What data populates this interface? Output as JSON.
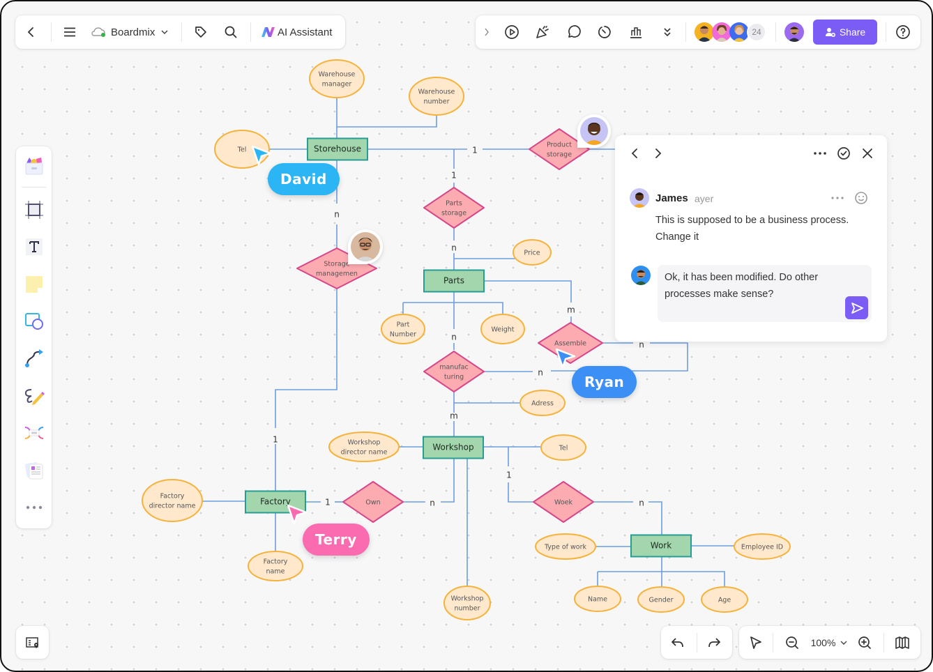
{
  "toolbar_left": {
    "back_icon": "chevron-left-icon",
    "menu_icon": "hamburger-menu-icon",
    "board_name": "Boardmix",
    "cloud_status": "synced",
    "tag_icon": "tag-icon",
    "search_icon": "search-icon",
    "ai_assistant_label": "AI Assistant"
  },
  "toolbar_right": {
    "expand_icon": "chevron-right-icon",
    "tools": [
      "present-icon",
      "celebrate-icon",
      "comment-icon",
      "timer-icon",
      "vote-icon",
      "more-chevrons-icon"
    ],
    "collaborator_count": "24",
    "share_label": "Share",
    "help_icon": "help-icon"
  },
  "left_toolbar": {
    "items": [
      "templates",
      "frame",
      "text",
      "sticky-note",
      "shapes",
      "connector",
      "pen",
      "mind-map",
      "document",
      "more"
    ]
  },
  "diagram": {
    "entities": [
      {
        "id": "storehouse",
        "label": "Storehouse"
      },
      {
        "id": "parts",
        "label": "Parts"
      },
      {
        "id": "workshop",
        "label": "Workshop"
      },
      {
        "id": "factory",
        "label": "Factory"
      },
      {
        "id": "work",
        "label": "Work"
      }
    ],
    "relationships": [
      {
        "id": "product-storage",
        "label": [
          "Product",
          "storage"
        ]
      },
      {
        "id": "parts-storage",
        "label": [
          "Parts",
          "storage"
        ]
      },
      {
        "id": "storage-management",
        "label": [
          "Storage",
          "managemen"
        ]
      },
      {
        "id": "assemble",
        "label": [
          "Assemble"
        ]
      },
      {
        "id": "manufacturing",
        "label": [
          "manufac",
          "turing"
        ]
      },
      {
        "id": "own",
        "label": [
          "Own"
        ]
      },
      {
        "id": "woek",
        "label": [
          "Woek"
        ]
      }
    ],
    "attributes": [
      {
        "id": "warehouse-manager",
        "label": [
          "Warehouse",
          "manager"
        ]
      },
      {
        "id": "warehouse-number",
        "label": [
          "Warehouse",
          "number"
        ]
      },
      {
        "id": "storehouse-tel",
        "label": [
          "Tel"
        ]
      },
      {
        "id": "price",
        "label": [
          "Price"
        ]
      },
      {
        "id": "part-number",
        "label": [
          "Part",
          "Number"
        ]
      },
      {
        "id": "weight",
        "label": [
          "Weight"
        ]
      },
      {
        "id": "adress",
        "label": [
          "Adress"
        ]
      },
      {
        "id": "workshop-director-name",
        "label": [
          "Workshop",
          "director name"
        ]
      },
      {
        "id": "workshop-tel",
        "label": [
          "Tel"
        ]
      },
      {
        "id": "workshop-number",
        "label": [
          "Workshop",
          "number"
        ]
      },
      {
        "id": "factory-director-name",
        "label": [
          "Factory",
          "director name"
        ]
      },
      {
        "id": "factory-name",
        "label": [
          "Factory",
          "name"
        ]
      },
      {
        "id": "type-of-work",
        "label": [
          "Type of work"
        ]
      },
      {
        "id": "employee-id",
        "label": [
          "Employee ID"
        ]
      },
      {
        "id": "name",
        "label": [
          "Name"
        ]
      },
      {
        "id": "gender",
        "label": [
          "Gender"
        ]
      },
      {
        "id": "age",
        "label": [
          "Age"
        ]
      }
    ],
    "cardinalities": [
      "1",
      "1",
      "n",
      "n",
      "m",
      "n",
      "n",
      "n",
      "m",
      "1",
      "1",
      "n",
      "1",
      "n"
    ]
  },
  "cursors": [
    {
      "name": "David",
      "color": "#2bb5f5"
    },
    {
      "name": "Ryan",
      "color": "#3b8ff5"
    },
    {
      "name": "Terry",
      "color": "#fa6bb0"
    }
  ],
  "comment_panel": {
    "author": "James",
    "time": "ayer",
    "message": "This is supposed to be a business process. Change it",
    "reply_text": "Ok, it has been modified. Do other processes make sense?"
  },
  "bottom_bar": {
    "zoom_level": "100%"
  },
  "colors": {
    "accent": "#7b5cf5",
    "entity_fill": "#a3d6ad",
    "entity_stroke": "#279c93",
    "relationship_fill": "#fcabb0",
    "relationship_stroke": "#d6478a",
    "attribute_fill": "#ffe8cc",
    "attribute_stroke": "#f5b23c",
    "connector": "#6b9de0"
  }
}
